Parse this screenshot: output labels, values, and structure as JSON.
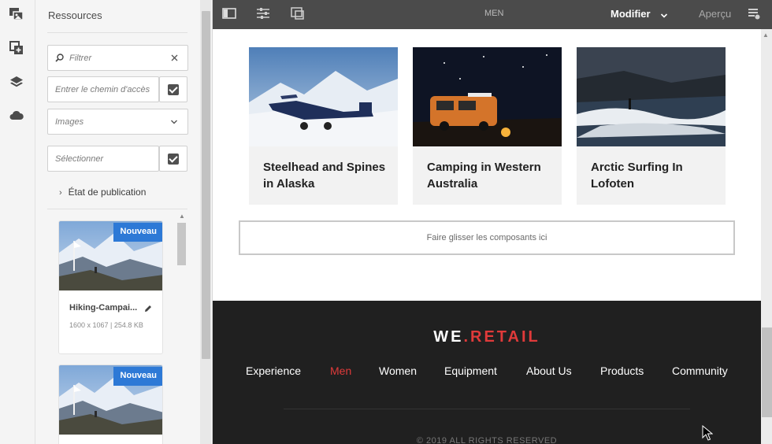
{
  "rail": {
    "icons": [
      "assets-icon",
      "components-icon",
      "layers-icon",
      "cloud-icon"
    ]
  },
  "panel": {
    "title": "Ressources",
    "filter_placeholder": "Filtrer",
    "path_placeholder": "Entrer le chemin d'accès",
    "type_select": "Images",
    "select_placeholder": "Sélectionner",
    "publication_state": "État de publication",
    "assets": [
      {
        "badge": "Nouveau",
        "name": "Hiking-Campai...",
        "meta": "1600 x 1067 | 254.8 KB"
      },
      {
        "badge": "Nouveau"
      }
    ]
  },
  "topbar": {
    "title": "MEN",
    "mode": "Modifier",
    "preview": "Aperçu"
  },
  "page": {
    "cards": [
      {
        "title": "Steelhead and Spines in Alaska"
      },
      {
        "title": "Camping in Western Australia"
      },
      {
        "title": "Arctic Surfing In Lofoten"
      }
    ],
    "dropzone": "Faire glisser les composants ici",
    "footer": {
      "logo_we": "WE",
      "logo_dot": ".",
      "logo_retail": "RETAIL",
      "nav": [
        "Experience",
        "Men",
        "Women",
        "Equipment",
        "About Us",
        "Products",
        "Community"
      ],
      "active_nav": "Men",
      "copyright": "© 2019 ALL RIGHTS RESERVED"
    }
  },
  "colors": {
    "accent_red": "#e03a3a",
    "badge_blue": "#2d79d6",
    "topbar": "#4b4b4b",
    "footer": "#202020"
  }
}
